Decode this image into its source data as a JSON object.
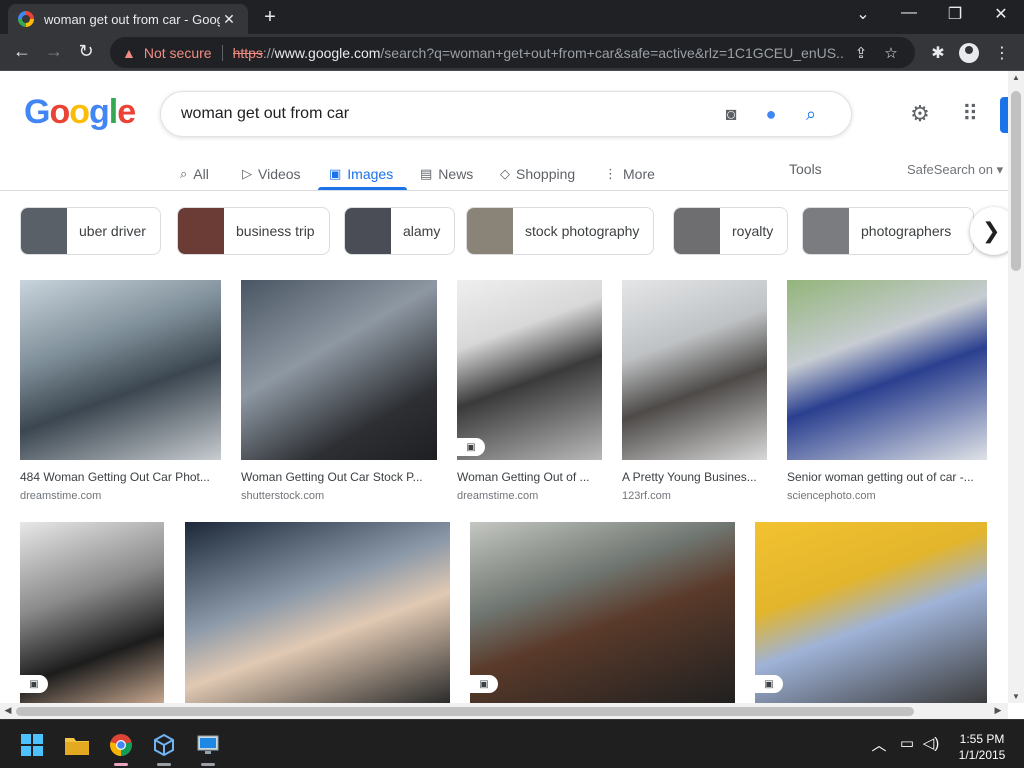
{
  "browser": {
    "tab_title": "woman get out from car - Google",
    "tab_close": "✕",
    "new_tab": "+",
    "window_controls": [
      "⌄",
      "—",
      "❐",
      "✕"
    ],
    "not_secure": "Not secure",
    "url_scheme": "https",
    "url_sep": "://",
    "url_host": "www.google.com",
    "url_rest": "/search?q=woman+get+out+from+car&safe=active&rlz=1C1GCEU_enUS..."
  },
  "search": {
    "logo": [
      "G",
      "o",
      "o",
      "g",
      "l",
      "e"
    ],
    "logo_colors": [
      "#4285f4",
      "#ea4335",
      "#fbbc05",
      "#4285f4",
      "#34a853",
      "#ea4335"
    ],
    "query": "woman get out from car"
  },
  "tabs": [
    {
      "label": "All",
      "icon": "search-icon",
      "glyph": "⌕"
    },
    {
      "label": "Videos",
      "icon": "video-icon",
      "glyph": "▷"
    },
    {
      "label": "Images",
      "icon": "image-icon",
      "glyph": "▣"
    },
    {
      "label": "News",
      "icon": "news-icon",
      "glyph": "▤"
    },
    {
      "label": "Shopping",
      "icon": "tag-icon",
      "glyph": "◇"
    },
    {
      "label": "More",
      "icon": "more-icon",
      "glyph": "⋮"
    }
  ],
  "tools": "Tools",
  "safesearch": "SafeSearch on ▾",
  "chips": [
    {
      "label": "uber driver",
      "color": "#5a6068"
    },
    {
      "label": "business trip",
      "color": "#6b3b35"
    },
    {
      "label": "alamy",
      "color": "#4a4d55"
    },
    {
      "label": "stock photography",
      "color": "#8a8378"
    },
    {
      "label": "royalty",
      "color": "#6e6e70"
    },
    {
      "label": "photographers",
      "color": "#7a7c80"
    }
  ],
  "results_row1": [
    {
      "caption": "484 Woman Getting Out Car Phot...",
      "source": "dreamstime.com",
      "bg": "linear-gradient(160deg,#c9d4dc 0%,#7f8f99 35%,#3b4650 60%,#c7ccd0 100%)"
    },
    {
      "caption": "Woman Getting Out Car Stock P...",
      "source": "shutterstock.com",
      "bg": "linear-gradient(150deg,#4a5563 0%,#8e98a3 40%,#2d2f33 75%,#1d1f22 100%)"
    },
    {
      "caption": "Woman Getting Out of ...",
      "source": "dreamstime.com",
      "bg": "linear-gradient(160deg,#efefef 0%,#d8d8d8 30%,#3a3a3a 55%,#b9b9b9 100%)"
    },
    {
      "caption": "A Pretty Young Busines...",
      "source": "123rf.com",
      "bg": "linear-gradient(160deg,#e4e6e8 0%,#bfc2c4 35%,#4d4a48 60%,#d9d9d9 100%)"
    },
    {
      "caption": "Senior woman getting out of car -...",
      "source": "sciencephoto.com",
      "bg": "linear-gradient(160deg,#93b57a 0%,#c7ccd2 35%,#2a3f8f 55%,#dfe2e6 100%)"
    }
  ],
  "results_row2": [
    {
      "bg": "linear-gradient(160deg,#e8e8e8 0%,#8a8a8a 40%,#1c1c1c 70%,#c7a78f 100%)"
    },
    {
      "bg": "linear-gradient(160deg,#1c2838 0%,#8a98a8 40%,#e1c9b3 60%,#2b2b2b 100%)"
    },
    {
      "bg": "linear-gradient(160deg,#c4c7c2 0%,#6f7570 35%,#5a3a2a 55%,#202020 100%)"
    },
    {
      "bg": "linear-gradient(160deg,#f2c230 0%,#e3b52b 35%,#9fb3d8 55%,#3b3b3b 100%)"
    }
  ],
  "clock": {
    "time": "1:55 PM",
    "date": "1/1/2015"
  }
}
